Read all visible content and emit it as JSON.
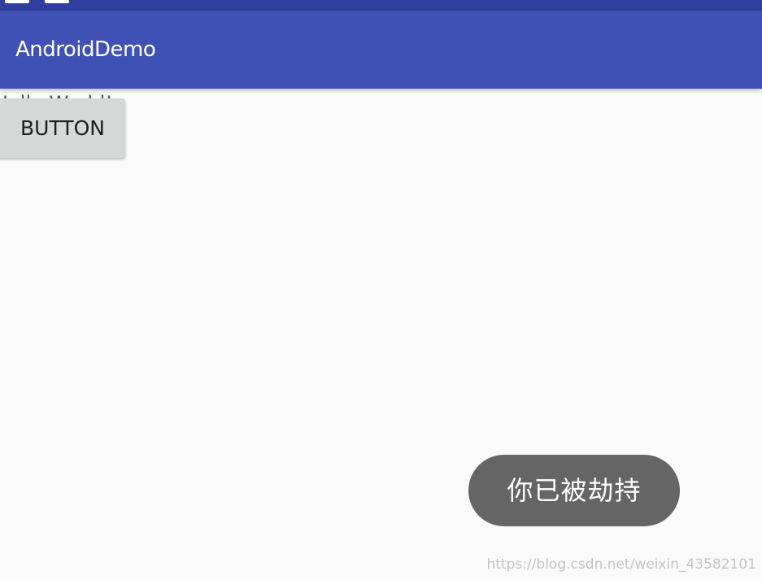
{
  "app_bar": {
    "title": "AndroidDemo"
  },
  "content": {
    "hello_text": "Hello World!",
    "button_label": "BUTTON"
  },
  "toast": {
    "message": "你已被劫持"
  },
  "watermark": {
    "text": "https://blog.csdn.net/weixin_43582101"
  },
  "colors": {
    "status_bar": "#303f9f",
    "app_bar": "#3f51b5",
    "background": "#fafafa",
    "button": "#d6d7d7",
    "toast": "#656565"
  }
}
